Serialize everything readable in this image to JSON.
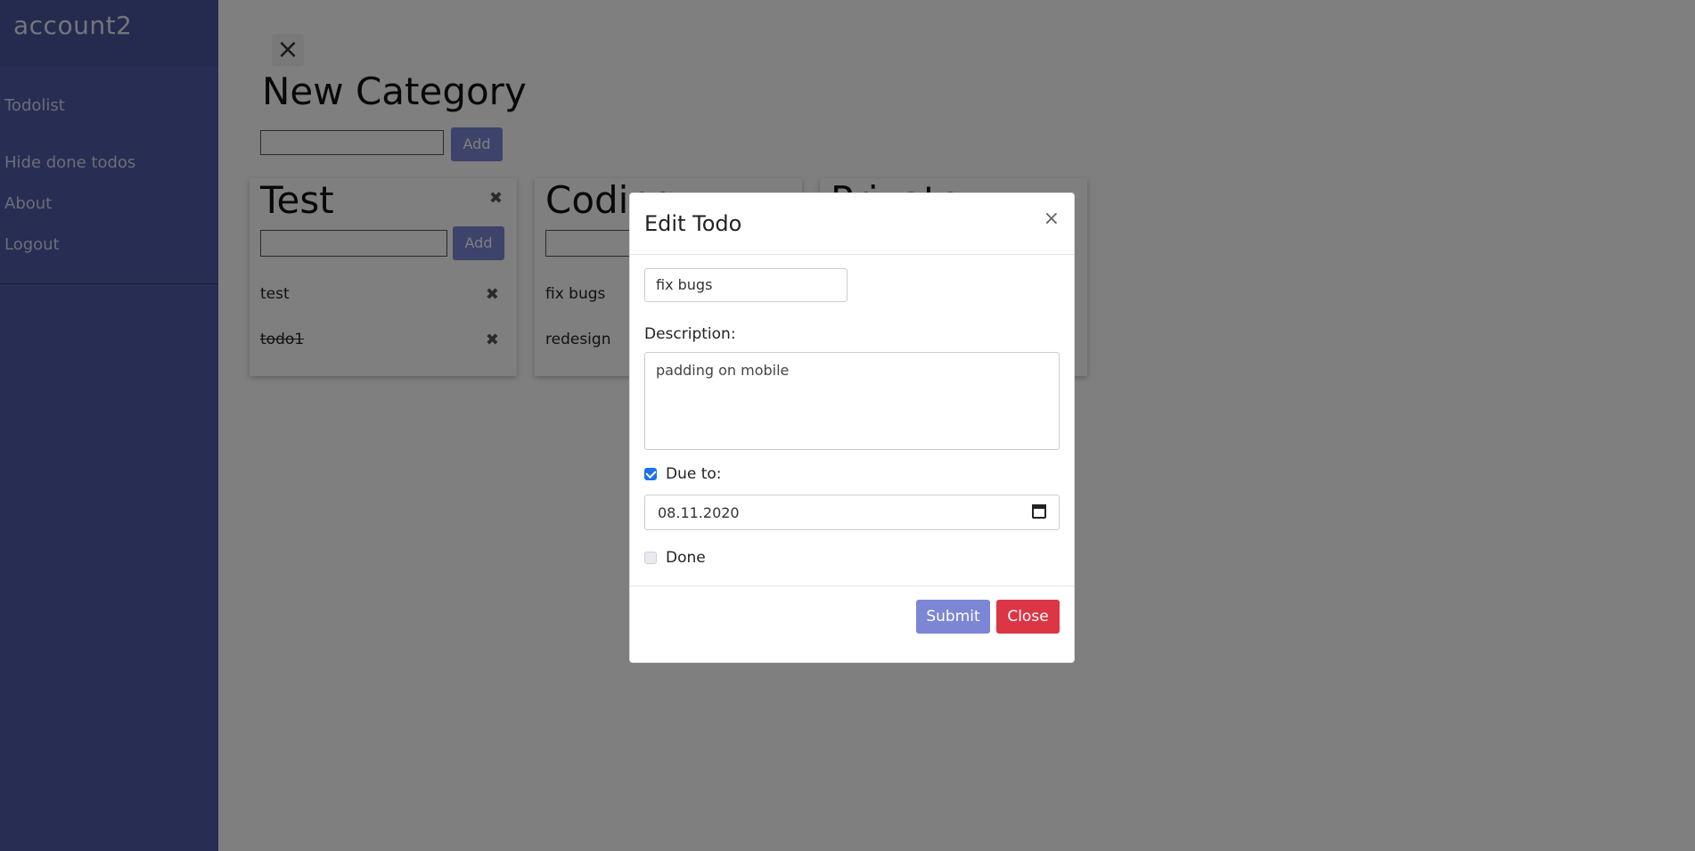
{
  "sidebar": {
    "brand": "account2",
    "items": [
      {
        "label": "Todolist"
      },
      {
        "label": "Hide done todos"
      },
      {
        "label": "About"
      },
      {
        "label": "Logout"
      }
    ]
  },
  "main": {
    "close_icon": "×",
    "title": "New Category",
    "add_label": "Add",
    "categories": [
      {
        "title": "Test",
        "todos": [
          {
            "text": "test",
            "done": false
          },
          {
            "text": "todo1",
            "done": true
          }
        ]
      },
      {
        "title": "Coding",
        "todos": [
          {
            "text": "fix bugs",
            "done": false
          },
          {
            "text": "redesign",
            "done": false
          }
        ]
      },
      {
        "title": "Private",
        "todos": []
      }
    ],
    "remove_icon": "✖"
  },
  "modal": {
    "title": "Edit Todo",
    "close_icon": "×",
    "title_value": "fix bugs",
    "description_label": "Description:",
    "description_value": "padding on mobile",
    "due_checked": true,
    "due_label": "Due to:",
    "due_value": "08.11.2020",
    "done_checked": false,
    "done_label": "Done",
    "submit_label": "Submit",
    "close_label": "Close"
  },
  "colors": {
    "sidebar": "#4e5aa6",
    "primary": "#7b86d4",
    "danger": "#dc3545",
    "overlay": "rgba(0,0,0,0.5)"
  }
}
